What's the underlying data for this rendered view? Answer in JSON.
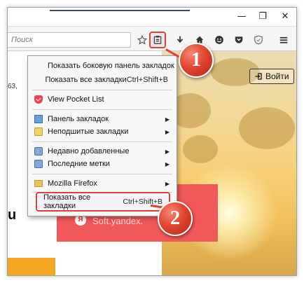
{
  "toolbar": {
    "search_placeholder": "Поиск",
    "icons": [
      "star-icon",
      "bookmarks-menu-icon",
      "download-icon",
      "home-icon",
      "smiley-icon",
      "pocket-icon",
      "shield-icon",
      "hamburger-menu-icon"
    ]
  },
  "window_controls": {
    "minimize": "—",
    "restore": "❐",
    "close": "✕"
  },
  "page": {
    "partial_number": "63,",
    "signin_label": "Войти",
    "yandex_text": "Soft.yandex.",
    "yandex_badge": "Я",
    "letter": "u"
  },
  "menu": {
    "items": [
      {
        "label": "Показать боковую панель закладок",
        "shortcut": "",
        "submenu": false,
        "icon": "none"
      },
      {
        "label": "Показать все закладки",
        "shortcut": "Ctrl+Shift+B",
        "submenu": false,
        "icon": "none"
      },
      {
        "label": "View Pocket List",
        "shortcut": "",
        "submenu": false,
        "icon": "pocket-icon"
      },
      {
        "label": "Панель закладок",
        "shortcut": "",
        "submenu": true,
        "icon": "bookmarks-toolbar-icon"
      },
      {
        "label": "Неподшитые закладки",
        "shortcut": "",
        "submenu": true,
        "icon": "unsorted-bookmarks-icon"
      },
      {
        "label": "Недавно добавленные",
        "shortcut": "",
        "submenu": true,
        "icon": "recently-bookmarked-icon"
      },
      {
        "label": "Последние метки",
        "shortcut": "",
        "submenu": true,
        "icon": "recent-tags-icon"
      },
      {
        "label": "Mozilla Firefox",
        "shortcut": "",
        "submenu": true,
        "icon": "folder-icon"
      }
    ],
    "footer": {
      "label": "Показать все закладки",
      "shortcut": "Ctrl+Shift+B"
    }
  },
  "annotations": {
    "step1": "1",
    "step2": "2"
  },
  "colors": {
    "highlight": "#d9423a",
    "badge": "#e2452f",
    "pocket": "#ef4056",
    "banner": "#f1585a"
  }
}
